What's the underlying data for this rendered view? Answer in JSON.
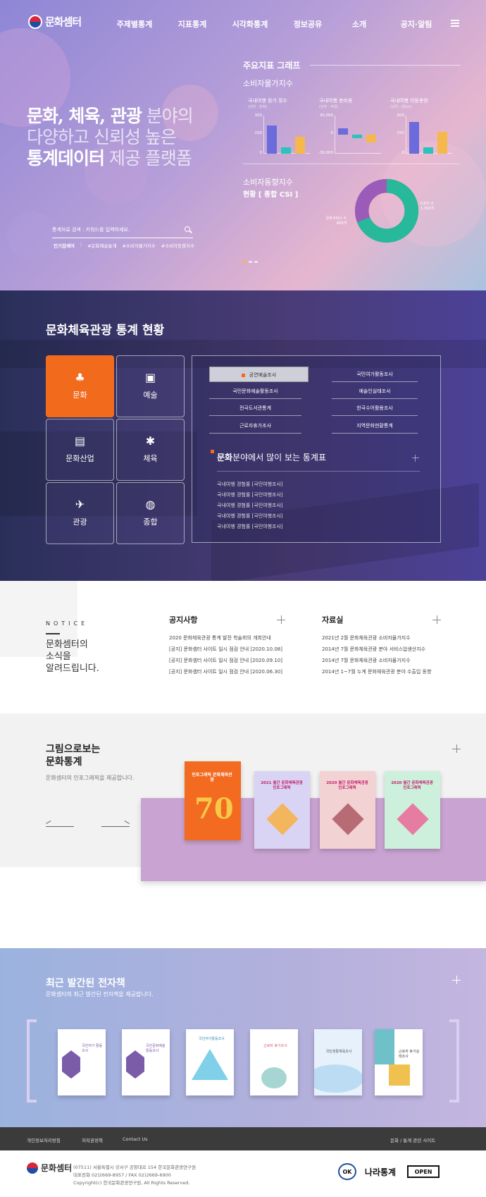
{
  "header": {
    "logo_text": "문화셈터",
    "nav": [
      "주제별통계",
      "지표통계",
      "시각화통계",
      "정보공유",
      "소개",
      "공지·알림"
    ]
  },
  "hero": {
    "line1_bold": "문화, 체육, 관광",
    "line1_rest": " 분야의",
    "line2": "다양하고 신뢰성 높은",
    "line3_bold": "통계데이터",
    "line3_rest": " 제공 플랫폼",
    "search_placeholder": "통계자료 검색 : 키워드를 입력하세요.",
    "popular_label": "인기검색어",
    "popular_tags": [
      "#문화예술통계",
      "#소비자물가지수",
      "#소비자동향지수"
    ]
  },
  "graph": {
    "title": "주요지표 그래프",
    "cpi_title": "소비자물가지수",
    "charts": [
      {
        "title": "국내여행 참가 횟수",
        "sub": "(단위 : 만회)",
        "ticks": [
          "300",
          "150",
          "0"
        ],
        "values": [
          220,
          50,
          135
        ],
        "ymax": 300,
        "ymin": 0
      },
      {
        "title": "국내여행 총비용",
        "sub": "(단위 : 억원)",
        "ticks": [
          "30,000",
          "0",
          "-30,000"
        ],
        "values": [
          10000,
          -5000,
          -12000
        ],
        "ymax": 30000,
        "ymin": -30000
      },
      {
        "title": "국내여행 이동총량",
        "sub": "(단위 : 만km)",
        "ticks": [
          "500",
          "250",
          "0"
        ],
        "values": [
          420,
          80,
          290
        ],
        "ymax": 500,
        "ymin": 0
      }
    ],
    "csi_title": "소비자동향지수",
    "csi_label": "현황  [ 종합 CSI ]",
    "donut": {
      "outer_label": "스포츠 수",
      "outer_value": "1,350개",
      "inner_label": "문화서비스 수",
      "inner_value": "600개",
      "outer_share": 0.69,
      "inner_share": 0.31
    }
  },
  "stats": {
    "title": "문화체육관광 통계 현황",
    "categories": [
      "문화",
      "예술",
      "문화산업",
      "체육",
      "관광",
      "종합"
    ],
    "surveys": [
      "공연예술조사",
      "국민여가활동조사",
      "국민문화예술활동조사",
      "예술인실태조사",
      "전국도서관통계",
      "한국수어활용조사",
      "근로자휴가조사",
      "지역문화현황통계"
    ],
    "popular_title_bold": "문화",
    "popular_title_rest": "분야에서 많이 보는 통계표",
    "popular_items": [
      "국내여행 경험률 [국민여행조사]",
      "국내여행 경험률 [국민여행조사]",
      "국내여행 경험률 [국민여행조사]",
      "국내여행 경험률 [국민여행조사]",
      "국내여행 경험률 [국민여행조사]"
    ]
  },
  "notice": {
    "tag": "NOTICE",
    "heading": [
      "문화셈터의",
      "소식을",
      "알려드립니다."
    ],
    "announcements_title": "공지사항",
    "announcements": [
      "2020 문화체육관광 통계 발전 학술회의 개최안내",
      "[공지] 문화셈터 사이트 일시 점검 안내 [2020.10.08]",
      "[공지] 문화셈터 사이트 일시 점검 안내 [2020.09.10]",
      "[공지] 문화셈터 사이트 일시 점검 안내 [2020.06.30]"
    ],
    "archive_title": "자료실",
    "archive": [
      "2021년 2월 문화체육관광 소비자물가지수",
      "2014년 7월 문화체육관광 분야 서비스업생산지수",
      "2014년 7월 문화체육관광 소비자물가지수",
      "2014년 1~7월 누계 문화체육관광 분야 수출입 동향"
    ]
  },
  "infographic": {
    "title": [
      "그림으로보는",
      "문화통계"
    ],
    "subtitle": "문화셈터의 인포그래픽을 제공합니다.",
    "books": [
      "인포그래픽 문화체육관광",
      "2021 월간 문화체육관광 인포그래픽",
      "2020 월간 문화체육관광 인포그래픽",
      "2020 월간 문화체육관광 인포그래픽"
    ]
  },
  "ebooks": {
    "title": "최근 발간된 전자책",
    "subtitle": "문화셈터의 최근 발간된 전자책을 제공합니다.",
    "covers": [
      "국민여가 활동조사",
      "국민문화예술 활동조사",
      "국민여가활동조사",
      "근로자 휴가조사",
      "국민생활체육조사",
      "근로자 휴가실태조사"
    ]
  },
  "footer": {
    "links": [
      "개인정보처리방침",
      "저작권정책",
      "Contact Us"
    ],
    "related": "문화 / 통계 관련 사이트",
    "address": "(07511) 서울특별시 강서구 공항대로 154 한국문화관광연구원",
    "phone": "대표전화 02)2669-8957 / FAX 02)2669-6900",
    "copyright": "Copyright(c) 한국문화관광연구원, All Rights Reserved.",
    "logo_text": "문화셈터",
    "badges": [
      "OK",
      "나라통계",
      "OPEN"
    ]
  }
}
